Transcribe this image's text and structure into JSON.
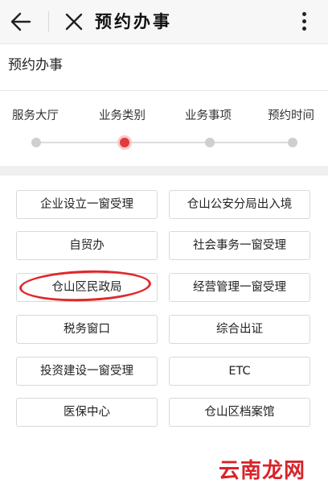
{
  "topbar": {
    "title": "预约办事"
  },
  "page": {
    "title": "预约办事"
  },
  "steps": [
    {
      "label": "服务大厅",
      "active": false
    },
    {
      "label": "业务类别",
      "active": true
    },
    {
      "label": "业务事项",
      "active": false
    },
    {
      "label": "预约时间",
      "active": false
    }
  ],
  "categories": [
    [
      "企业设立一窗受理",
      "仓山公安分局出入境"
    ],
    [
      "自贸办",
      "社会事务一窗受理"
    ],
    [
      "仓山区民政局",
      "经营管理一窗受理"
    ],
    [
      "税务窗口",
      "综合出证"
    ],
    [
      "投资建设一窗受理",
      "ETC"
    ],
    [
      "医保中心",
      "仓山区档案馆"
    ]
  ],
  "watermark": "云南龙网",
  "colors": {
    "accent": "#e03a3a",
    "highlight_oval": "#e0282a",
    "watermark": "#d8232a"
  }
}
